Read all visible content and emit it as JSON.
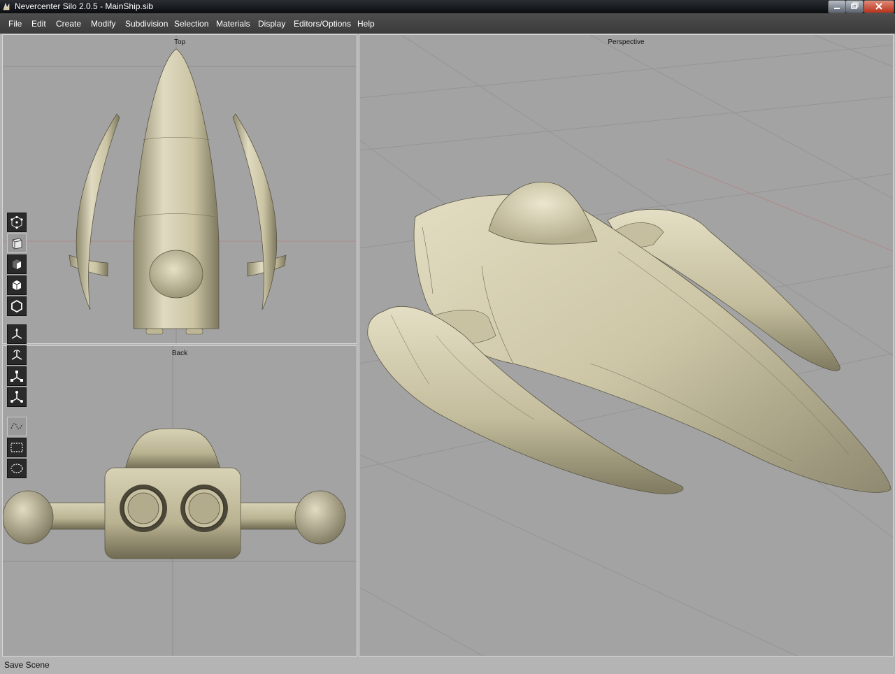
{
  "window": {
    "title": "Nevercenter Silo 2.0.5 - MainShip.sib"
  },
  "menu": [
    "File",
    "Edit",
    "Create",
    "Modify",
    "Subdivision",
    "Selection",
    "Materials",
    "Display",
    "Editors/Options",
    "Help"
  ],
  "viewports": {
    "top": "Top",
    "back": "Back",
    "perspective": "Perspective"
  },
  "status": {
    "text": "Save Scene"
  },
  "colors": {
    "model": "#cfc8a8",
    "viewport_bg": "#a3a3a3",
    "menubar": "#444444",
    "titlebar": "#0e1014"
  },
  "toolbar": {
    "items": [
      "vertex-mode-icon",
      "edge-mode-icon",
      "face-mode-icon",
      "object-mode-icon",
      "wireframe-object-icon",
      "move-manipulator-icon",
      "rotate-manipulator-icon",
      "scale-manipulator-icon",
      "universal-manipulator-icon",
      "lasso-select-icon",
      "rectangle-select-icon",
      "ellipse-select-icon"
    ],
    "active": "edge-mode-icon"
  }
}
